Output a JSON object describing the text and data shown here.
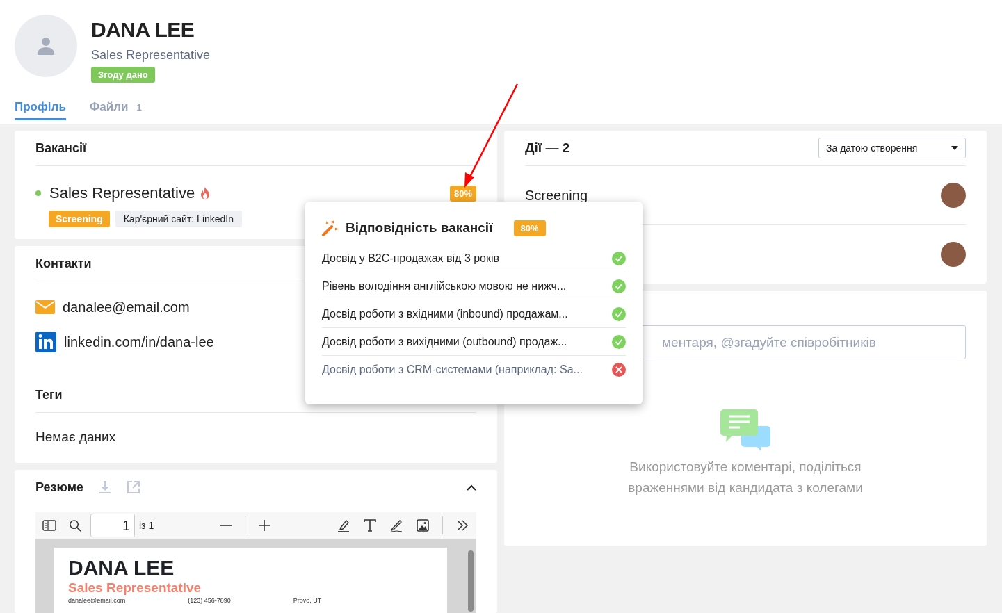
{
  "header": {
    "name": "DANA LEE",
    "position": "Sales Representative",
    "consent_badge": "Згоду дано"
  },
  "tabs": [
    {
      "label": "Профіль",
      "selected": true
    },
    {
      "label": "Файли",
      "count": "1",
      "selected": false
    }
  ],
  "vacancies": {
    "title": "Вакансії",
    "items": [
      {
        "name": "Sales Representative",
        "hot": true,
        "active": true,
        "match": "80%",
        "stage": "Screening",
        "source": "Кар'єрний сайт: LinkedIn"
      }
    ]
  },
  "contacts": {
    "title": "Контакти",
    "items": [
      {
        "kind": "email",
        "value": "danalee@email.com"
      },
      {
        "kind": "linkedin",
        "value": "linkedin.com/in/dana-lee"
      }
    ]
  },
  "tags": {
    "title": "Теги",
    "empty": "Немає даних"
  },
  "resume": {
    "title": "Резюме",
    "page": "1",
    "page_total": "із 1",
    "document": {
      "name": "DANA LEE",
      "position": "Sales Representative",
      "contacts": [
        "danalee@email.com",
        "(123) 456-7890",
        "Provo, UT"
      ]
    }
  },
  "actions": {
    "title": "Дії — 2",
    "sort": "За датою створення",
    "items": [
      {
        "kind": "labeled",
        "label": "Screening"
      },
      {
        "kind": "covered"
      }
    ]
  },
  "comments": {
    "placeholder": "ментаря, @згадуйте співробітників",
    "empty_text": "Використовуйте коментарі, поділіться враженнями від кандидата з колегами"
  },
  "match_popup": {
    "title": "Відповідність вакансії",
    "score": "80%",
    "criteria": [
      {
        "text": "Досвід у B2C-продажах від 3 років",
        "met": true
      },
      {
        "text": "Рівень володіння англійською мовою не нижч...",
        "met": true
      },
      {
        "text": "Досвід роботи з вхідними (inbound) продажам...",
        "met": true
      },
      {
        "text": "Досвід роботи з вихідними (outbound) продаж...",
        "met": true
      },
      {
        "text": "Досвід роботи з CRM-системами (наприклад: Sa...",
        "met": false
      }
    ]
  }
}
